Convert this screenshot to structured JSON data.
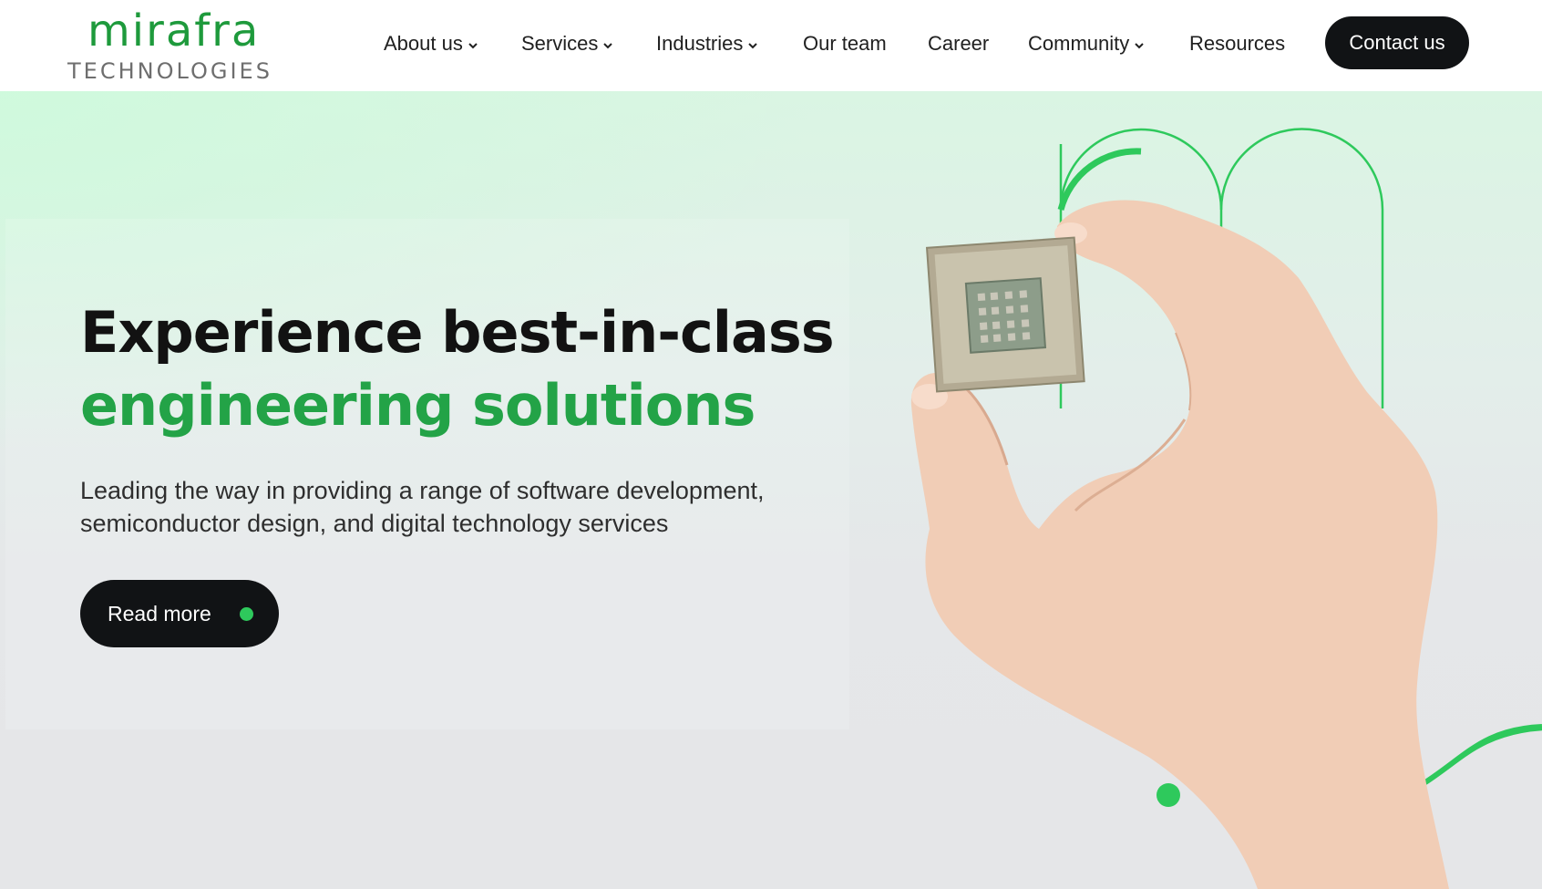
{
  "brand": {
    "name": "mirafra",
    "tagline": "TECHNOLOGIES"
  },
  "nav": {
    "items": [
      {
        "label": "About us",
        "dropdown": true
      },
      {
        "label": "Services",
        "dropdown": true
      },
      {
        "label": "Industries",
        "dropdown": true
      },
      {
        "label": "Our team",
        "dropdown": false
      },
      {
        "label": "Career",
        "dropdown": false
      },
      {
        "label": "Community",
        "dropdown": true
      },
      {
        "label": "Resources",
        "dropdown": false
      }
    ],
    "cta_label": "Contact us"
  },
  "hero": {
    "headline_line1": "Experience best-in-class",
    "headline_line2": "engineering solutions",
    "subtext": "Leading the way in providing a range of software development, semiconductor design, and digital technology services",
    "button_label": "Read more"
  },
  "colors": {
    "brand_green": "#23a347",
    "accent_green": "#2ec95c",
    "dark": "#111315"
  },
  "icons": {
    "dropdown": "chevron-down-icon",
    "button_dot": "green-dot-icon"
  }
}
